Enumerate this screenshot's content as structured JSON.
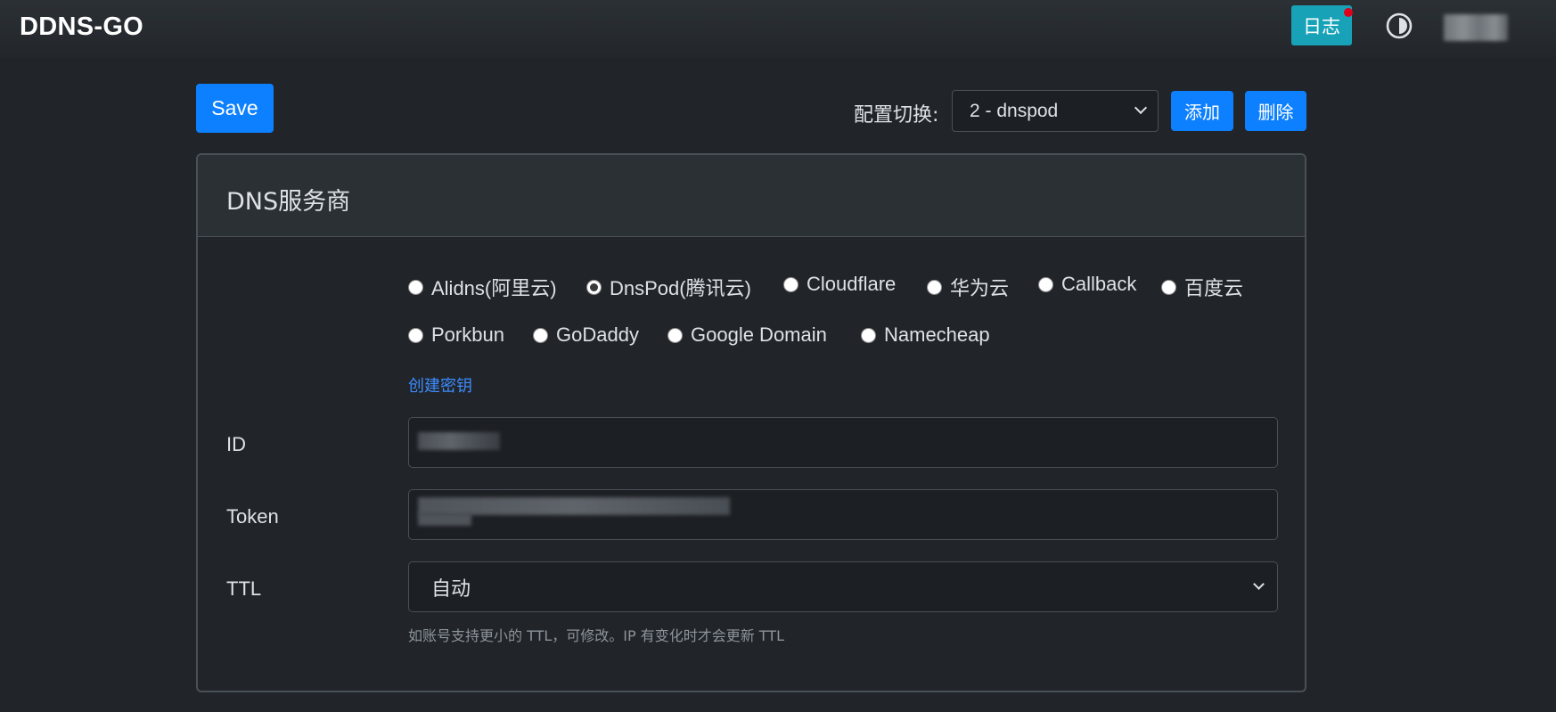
{
  "brand": "DDNS-GO",
  "header": {
    "log_label": "日志",
    "theme_icon": "half-circle-contrast-icon"
  },
  "toolbar": {
    "save_label": "Save",
    "config_label": "配置切换:",
    "config_selected": "2 - dnspod",
    "add_label": "添加",
    "delete_label": "删除"
  },
  "card": {
    "title": "DNS服务商",
    "providers": [
      {
        "label": "Alidns(阿里云)",
        "checked": false
      },
      {
        "label": "DnsPod(腾讯云)",
        "checked": true
      },
      {
        "label": "Cloudflare",
        "checked": false
      },
      {
        "label": "华为云",
        "checked": false
      },
      {
        "label": "Callback",
        "checked": false
      },
      {
        "label": "百度云",
        "checked": false
      },
      {
        "label": "Porkbun",
        "checked": false
      },
      {
        "label": "GoDaddy",
        "checked": false
      },
      {
        "label": "Google Domain",
        "checked": false
      },
      {
        "label": "Namecheap",
        "checked": false
      }
    ],
    "create_key_link": "创建密钥",
    "id_label": "ID",
    "token_label": "Token",
    "ttl_label": "TTL",
    "ttl_selected": "自动",
    "ttl_help": "如账号支持更小的 TTL，可修改。IP 有变化时才会更新 TTL"
  },
  "colors": {
    "accent": "#0d80ff",
    "log_button": "#17a2b8",
    "notification_dot": "#e0001a",
    "link": "#3d8bfd"
  }
}
